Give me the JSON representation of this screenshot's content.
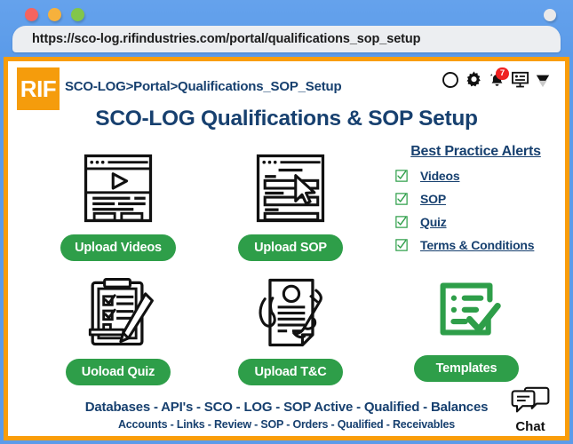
{
  "browser": {
    "url": "https://sco-log.rifindustries.com/portal/qualifications_sop_setup",
    "traffic_lights": [
      "close-red",
      "minimize-yellow",
      "maximize-green"
    ]
  },
  "header": {
    "logo_text": "RIF",
    "breadcrumb": "SCO-LOG>Portal>Qualifications_SOP_Setup",
    "page_title": "SCO-LOG Qualifications & SOP Setup",
    "icons": [
      {
        "name": "circle-icon",
        "glyph": "circle"
      },
      {
        "name": "gear-icon",
        "glyph": "gear"
      },
      {
        "name": "bell-icon",
        "glyph": "bell",
        "badge": "7"
      },
      {
        "name": "presentation-icon",
        "glyph": "presentation"
      },
      {
        "name": "chevron-down-icon",
        "glyph": "chevron-down"
      }
    ]
  },
  "cards": [
    {
      "id": "videos",
      "icon": "video-page-icon",
      "button": "Upload Videos"
    },
    {
      "id": "sop",
      "icon": "document-cursor-icon",
      "button": "Upload SOP"
    },
    {
      "id": "quiz",
      "icon": "clipboard-pencil-icon",
      "button": "Uoload Quiz"
    },
    {
      "id": "tc",
      "icon": "contract-signing-icon",
      "button": "Upload T&C"
    },
    {
      "id": "templates",
      "icon": "checklist-check-icon",
      "button": "Templates"
    }
  ],
  "alerts": {
    "title": "Best Practice Alerts",
    "items": [
      {
        "label": "Videos",
        "checked": true
      },
      {
        "label": "SOP",
        "checked": true
      },
      {
        "label": "Quiz",
        "checked": true
      },
      {
        "label": "Terms & Conditions",
        "checked": true
      }
    ]
  },
  "footer": {
    "line1": "Databases - API's - SCO - LOG - SOP Active - Qualified - Balances",
    "line2": "Accounts - Links - Review - SOP - Orders - Qualified - Receivables"
  },
  "chat": {
    "label": "Chat",
    "icon": "chat-bubbles-icon"
  },
  "colors": {
    "brand_orange": "#f59c0c",
    "navy": "#17406f",
    "green": "#2e9e49",
    "badge_red": "#ef2121",
    "chrome_blue": "#5b9be9"
  }
}
